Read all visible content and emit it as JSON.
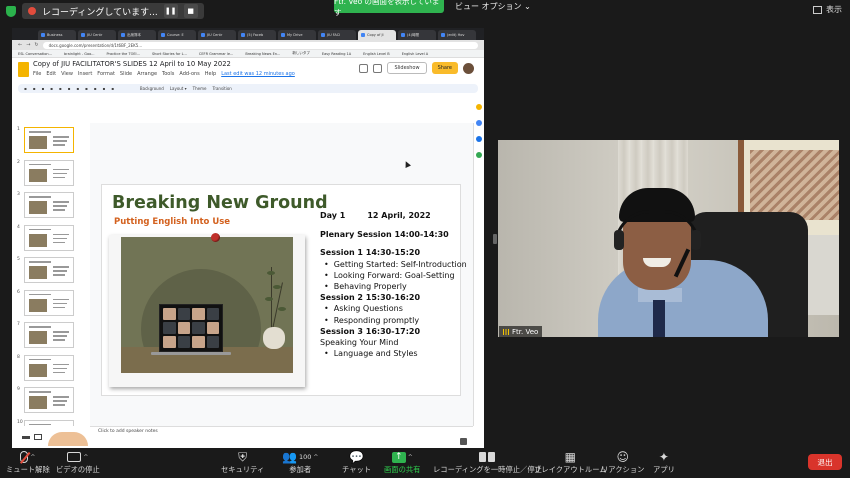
{
  "zoom_top": {
    "recording_label": "レコーディングしています...",
    "share_banner": "Ftr. Veo の画面を表示しています",
    "view_options": "ビュー オプション ⌄",
    "display": "表示"
  },
  "browser": {
    "tabs": [
      "Business",
      "JIU Centr",
      "出席簿本",
      "Course: E",
      "JIU Centr",
      "(5) Faceb",
      "My Drive",
      "JIU FACI",
      "Copy of JI",
      "(4)時間",
      "(edit) Hov"
    ],
    "active_tab_index": 8,
    "url": "docs.google.com/presentation/d/1t6BF_2EK5...",
    "bookmarks": [
      "ESL Conversation...",
      "brainlight - Goo...",
      "Practice the TOEI...",
      "Short Stories for L...",
      "CEFR Grammar le...",
      "Breaking News En...",
      "新しいタブ",
      "Easy Reading 1A",
      "English Level B",
      "English Level A"
    ]
  },
  "doc": {
    "title": "Copy of JIU FACILITATOR'S SLIDES 12 April to 10 May 2022",
    "menu": [
      "File",
      "Edit",
      "View",
      "Insert",
      "Format",
      "Slide",
      "Arrange",
      "Tools",
      "Add-ons",
      "Help"
    ],
    "last_edit": "Last edit was 12 minutes ago",
    "slideshow": "Slideshow",
    "share": "Share",
    "toolbar_labels": [
      "Background",
      "Layout ▾",
      "Theme",
      "Transition"
    ],
    "speaker_notes": "Click to add speaker notes"
  },
  "filmstrip": {
    "numbers": [
      "1",
      "2",
      "3",
      "4",
      "5",
      "6",
      "7",
      "8",
      "9",
      "10",
      "11"
    ]
  },
  "slide": {
    "title": "Breaking New Ground",
    "subtitle": "Putting English Into Use",
    "day": "Day 1",
    "date": "12 April, 2022",
    "plenary": "Plenary Session 14:00-14:30",
    "session1": "Session 1 14:30-15:20",
    "s1_items": [
      "Getting Started: Self-Introduction",
      "Looking Forward: Goal-Setting",
      "Behaving Properly"
    ],
    "session2": "Session 2 15:30-16:20",
    "s2_items": [
      "Asking Questions",
      "Responding promptly"
    ],
    "session3": "Session 3 16:30-17:20",
    "s3_plain": "Speaking Your Mind",
    "s3_items": [
      "Language and Styles"
    ]
  },
  "video": {
    "participant_name": "Ftr. Veo"
  },
  "bottombar": {
    "mute": "ミュート解除",
    "video": "ビデオの停止",
    "security": "セキュリティ",
    "participants": "参加者",
    "participants_count": "100",
    "chat": "チャット",
    "share": "画面の共有",
    "recording": "レコーディングを一時停止／停止",
    "breakout": "ブレイクアウトルーム",
    "reaction": "リアクション",
    "apps": "アプリ",
    "leave": "退出"
  },
  "colors": {
    "slide_title": "#3e5a2a",
    "slide_subtitle": "#d3611e",
    "share_green": "#2fb34f",
    "leave_red": "#d9342b",
    "share_button": "#f9bb2a"
  }
}
